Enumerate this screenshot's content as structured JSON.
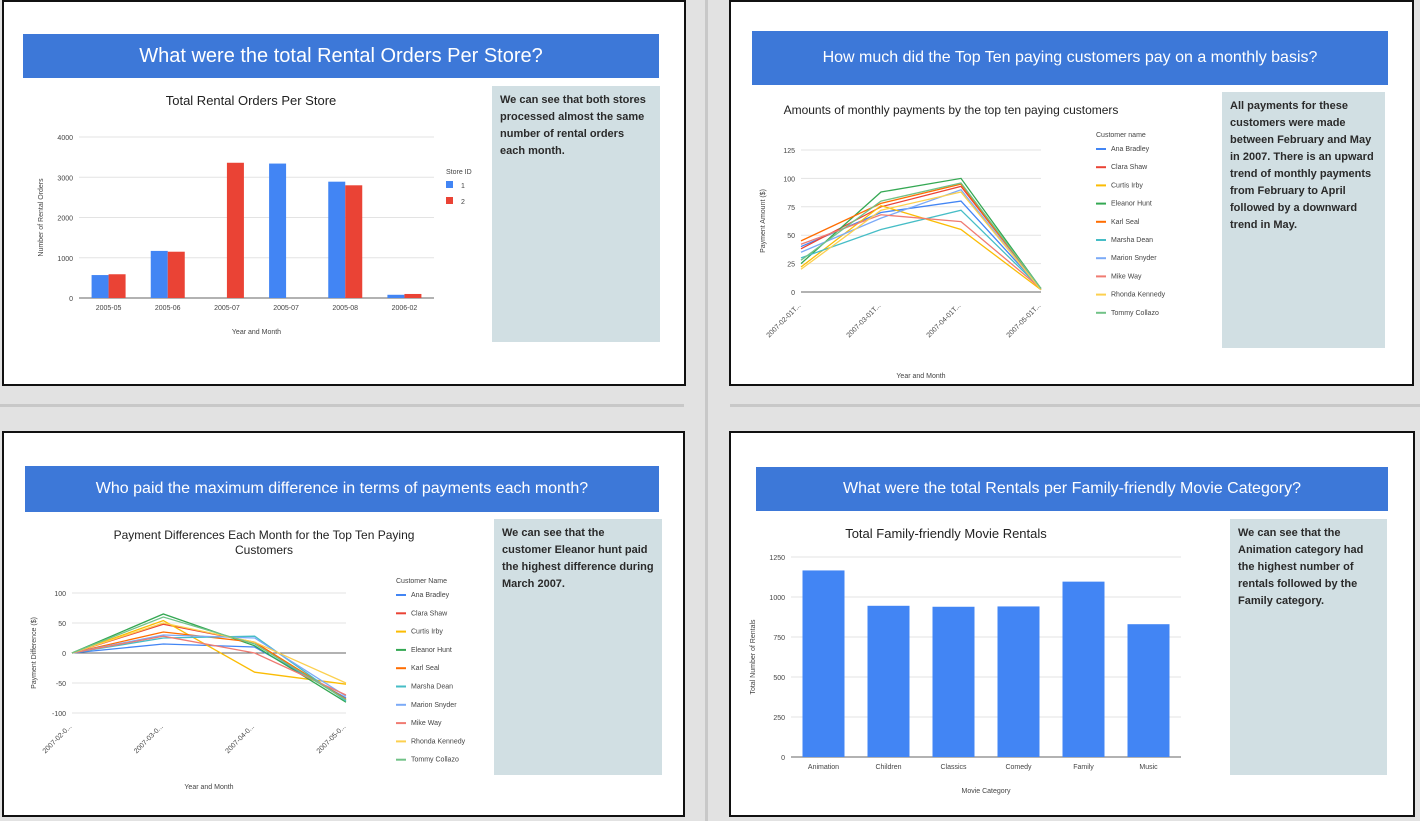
{
  "slides": [
    {
      "title": "What were the total Rental Orders Per Store?",
      "note": "We can see that both stores processed almost the same number of rental orders each month.",
      "chart_data": {
        "type": "bar",
        "title": "Total Rental Orders Per Store",
        "xlabel": "Year and Month",
        "ylabel": "Number of Rental Orders",
        "categories": [
          "2005-05",
          "2005-06",
          "2005-07",
          "2005-07",
          "2005-08",
          "2006-02"
        ],
        "ylim": [
          0,
          4000
        ],
        "yticks": [
          "0",
          "1000",
          "2000",
          "3000",
          "4000"
        ],
        "legend_title": "Store ID",
        "legend_position": "right",
        "series": [
          {
            "name": "1",
            "color": "#4285f4",
            "values": [
              570,
              1170,
              null,
              3340,
              2890,
              80
            ]
          },
          {
            "name": "2",
            "color": "#ea4335",
            "values": [
              590,
              1150,
              3360,
              null,
              2800,
              100
            ]
          }
        ]
      }
    },
    {
      "title": "How much did the Top Ten paying customers pay on a monthly basis?",
      "note": "All payments for these customers were made between February and May in 2007. There is an upward trend of monthly payments from February to April followed by a downward trend in May.",
      "chart_data": {
        "type": "line",
        "title": "Amounts of monthly payments by the top ten paying customers",
        "xlabel": "Year and Month",
        "ylabel": "Payment Amount ($)",
        "x": [
          "2007-02-01T...",
          "2007-03-01T...",
          "2007-04-01T...",
          "2007-05-01T..."
        ],
        "ylim": [
          0,
          125
        ],
        "yticks": [
          "0",
          "25",
          "50",
          "75",
          "100",
          "125"
        ],
        "legend_title": "Customer name",
        "legend_position": "right",
        "series": [
          {
            "name": "Ana Bradley",
            "color": "#4285f4",
            "values": [
              40,
              70,
              80,
              3
            ]
          },
          {
            "name": "Clara Shaw",
            "color": "#ea4335",
            "values": [
              38,
              75,
              93,
              3
            ]
          },
          {
            "name": "Curtis Irby",
            "color": "#fbbc04",
            "values": [
              22,
              76,
              55,
              2
            ]
          },
          {
            "name": "Eleanor Hunt",
            "color": "#34a853",
            "values": [
              25,
              88,
              100,
              3
            ]
          },
          {
            "name": "Karl Seal",
            "color": "#ff6d01",
            "values": [
              45,
              78,
              95,
              2
            ]
          },
          {
            "name": "Marsha Dean",
            "color": "#46bdc6",
            "values": [
              30,
              55,
              72,
              3
            ]
          },
          {
            "name": "Marion Snyder",
            "color": "#7baaf7",
            "values": [
              35,
              65,
              90,
              2
            ]
          },
          {
            "name": "Mike Way",
            "color": "#f07b72",
            "values": [
              42,
              68,
              62,
              3
            ]
          },
          {
            "name": "Rhonda Kennedy",
            "color": "#fcd04f",
            "values": [
              20,
              72,
              88,
              2
            ]
          },
          {
            "name": "Tommy Collazo",
            "color": "#71c287",
            "values": [
              28,
              80,
              96,
              3
            ]
          }
        ]
      }
    },
    {
      "title": "Who paid the maximum difference in terms of payments each month?",
      "note": "We can see that the customer Eleanor hunt paid the highest difference during March 2007.",
      "chart_data": {
        "type": "line",
        "title": "Payment Differences Each Month for the Top Ten Paying Customers",
        "xlabel": "Year and Month",
        "ylabel": "Payment Difference ($)",
        "x": [
          "2007-02-0...",
          "2007-03-0...",
          "2007-04-0...",
          "2007-05-0..."
        ],
        "ylim": [
          -100,
          100
        ],
        "yticks": [
          "-100",
          "-50",
          "0",
          "50",
          "100"
        ],
        "legend_title": "Customer Name",
        "legend_position": "right",
        "series": [
          {
            "name": "Ana Bradley",
            "color": "#4285f4",
            "values": [
              0,
              15,
              10,
              -75
            ]
          },
          {
            "name": "Clara Shaw",
            "color": "#ea4335",
            "values": [
              0,
              48,
              18,
              -78
            ]
          },
          {
            "name": "Curtis Irby",
            "color": "#fbbc04",
            "values": [
              0,
              54,
              -32,
              -52
            ]
          },
          {
            "name": "Eleanor Hunt",
            "color": "#34a853",
            "values": [
              0,
              65,
              12,
              -82
            ]
          },
          {
            "name": "Karl Seal",
            "color": "#ff6d01",
            "values": [
              0,
              35,
              18,
              -77
            ]
          },
          {
            "name": "Marsha Dean",
            "color": "#46bdc6",
            "values": [
              0,
              25,
              28,
              -80
            ]
          },
          {
            "name": "Marion Snyder",
            "color": "#7baaf7",
            "values": [
              0,
              30,
              25,
              -72
            ]
          },
          {
            "name": "Mike Way",
            "color": "#f07b72",
            "values": [
              0,
              28,
              0,
              -70
            ]
          },
          {
            "name": "Rhonda Kennedy",
            "color": "#fcd04f",
            "values": [
              0,
              50,
              18,
              -50
            ]
          },
          {
            "name": "Tommy Collazo",
            "color": "#71c287",
            "values": [
              0,
              60,
              15,
              -78
            ]
          }
        ]
      }
    },
    {
      "title": "What were the total Rentals per Family-friendly Movie Category?",
      "note": "We can see that the Animation category had the highest number of rentals followed by the Family category.",
      "chart_data": {
        "type": "bar",
        "title": "Total Family-friendly Movie Rentals",
        "xlabel": "Movie Category",
        "ylabel": "Total Number of Rentals",
        "categories": [
          "Animation",
          "Children",
          "Classics",
          "Comedy",
          "Family",
          "Music"
        ],
        "values": [
          1166,
          945,
          939,
          941,
          1096,
          830
        ],
        "color": "#4285f4",
        "ylim": [
          0,
          1250
        ],
        "yticks": [
          "0",
          "250",
          "500",
          "750",
          "1000",
          "1250"
        ]
      }
    }
  ]
}
